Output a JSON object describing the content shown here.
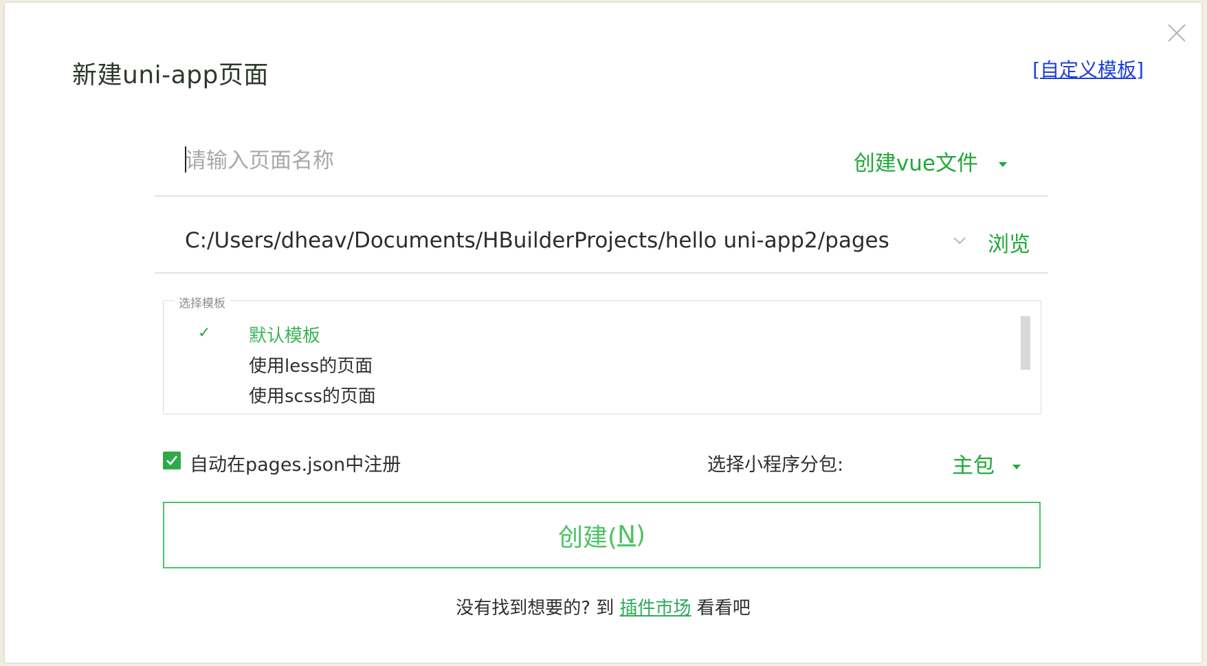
{
  "dialog": {
    "title": "新建uni-app页面",
    "custom_template": {
      "bracket_open": "[",
      "label": "自定义模板",
      "bracket_close": "]"
    }
  },
  "page_name": {
    "value": "",
    "placeholder": "请输入页面名称",
    "file_type": "创建vue文件"
  },
  "path": {
    "value": "C:/Users/dheav/Documents/HBuilderProjects/hello uni-app2/pages",
    "browse_label": "浏览"
  },
  "templates": {
    "legend": "选择模板",
    "check_mark": "✓",
    "items": [
      {
        "label": "默认模板",
        "selected": true
      },
      {
        "label": "使用less的页面",
        "selected": false
      },
      {
        "label": "使用scss的页面",
        "selected": false
      }
    ]
  },
  "options": {
    "auto_register_label": "自动在pages.json中注册",
    "auto_register_checked": true,
    "subpackage_label": "选择小程序分包:",
    "subpackage_value": "主包"
  },
  "create_button": {
    "label_prefix": "创建(",
    "shortcut": "N",
    "label_suffix": ")"
  },
  "footer": {
    "prefix": "没有找到想要的? 到 ",
    "link": "插件市场",
    "suffix": " 看看吧"
  },
  "colors": {
    "accent_green": "#20a83a",
    "button_green": "#4cc264",
    "link_blue": "#1d40d8"
  }
}
